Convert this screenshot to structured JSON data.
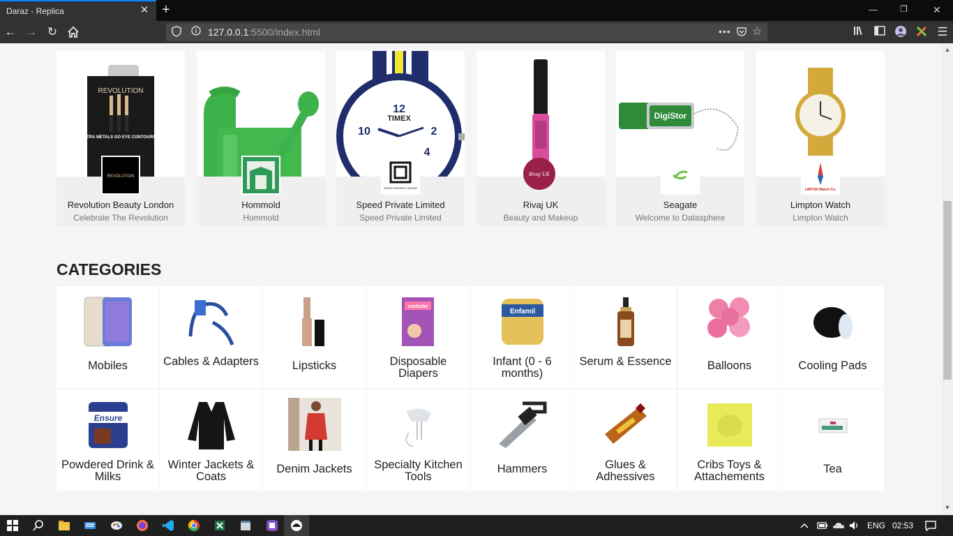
{
  "browser": {
    "tab_title": "Daraz - Replica",
    "url_host": "127.0.0.1",
    "url_rest": ":5500/index.html"
  },
  "stores": [
    {
      "name": "Revolution Beauty London",
      "tagline": "Celebrate The Revolution"
    },
    {
      "name": "Hommold",
      "tagline": "Hommold"
    },
    {
      "name": "Speed Private Limited",
      "tagline": "Speed Private Limited"
    },
    {
      "name": "Rivaj UK",
      "tagline": "Beauty and Makeup"
    },
    {
      "name": "Seagate",
      "tagline": "Welcome to Datasphere"
    },
    {
      "name": "Limpton Watch",
      "tagline": "Limpton Watch"
    }
  ],
  "store_image_text": {
    "revolution_logo": "REVOLUTION",
    "revolution_box": "ULTRA METALS GO EYE CONTOURING",
    "digistor": "DigiStor",
    "timex": "TIMEX",
    "rivaj": "Rivaj UK",
    "limpton": "LIMTON Watch Co.",
    "speed": "SPEED PRIVATE LIMITED"
  },
  "categories_heading": "CATEGORIES",
  "categories": [
    {
      "label": "Mobiles"
    },
    {
      "label": "Cables & Adapters"
    },
    {
      "label": "Lipsticks"
    },
    {
      "label": "Disposable Diapers"
    },
    {
      "label": "Infant (0 - 6 months)"
    },
    {
      "label": "Serum & Essence"
    },
    {
      "label": "Balloons"
    },
    {
      "label": "Cooling Pads"
    },
    {
      "label": "Powdered Drink & Milks"
    },
    {
      "label": "Winter Jackets & Coats"
    },
    {
      "label": "Denim Jackets"
    },
    {
      "label": "Specialty Kitchen Tools"
    },
    {
      "label": "Hammers"
    },
    {
      "label": "Glues & Adhessives"
    },
    {
      "label": "Cribs Toys & Attachements"
    },
    {
      "label": "Tea"
    }
  ],
  "category_image_text": {
    "ensure": "Ensure",
    "enfamil": "Enfamil",
    "canbebe": "canbebe"
  },
  "taskbar": {
    "language": "ENG",
    "time": "02:53"
  }
}
